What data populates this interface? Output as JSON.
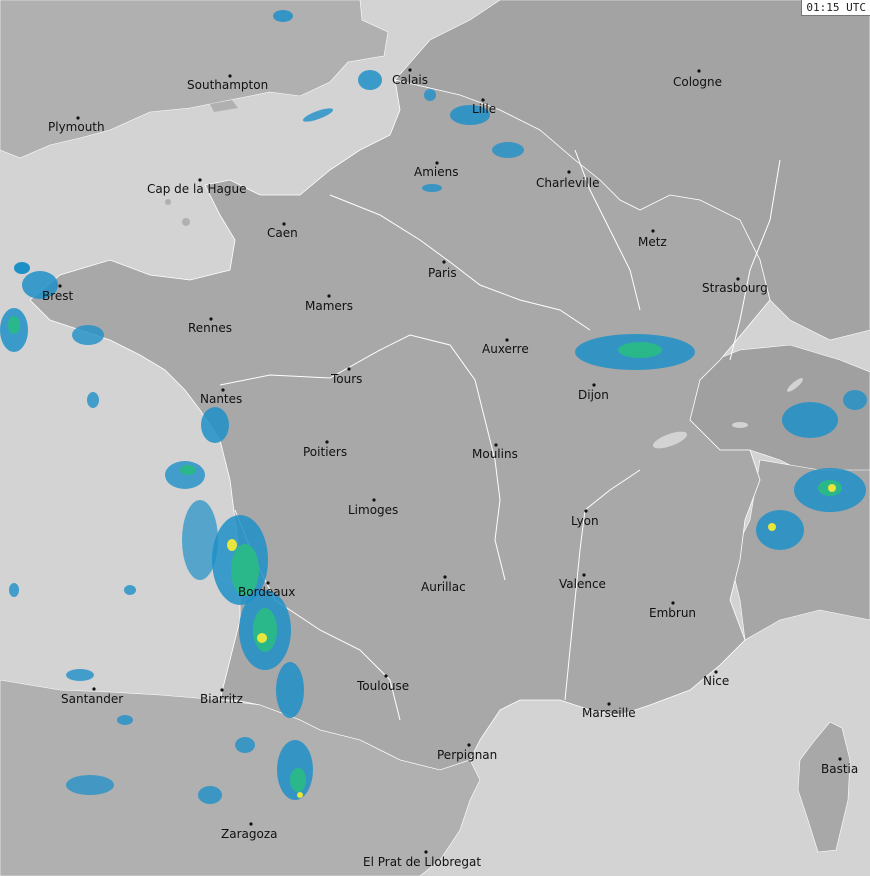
{
  "map": {
    "timestamp": "01:15 UTC",
    "colors": {
      "sea": "#d3d3d3",
      "land": "#b0b0b0",
      "france": "#a8a8a8",
      "borders": "#ffffff",
      "rain_light": "#1e90c8",
      "rain_mid": "#2ab88a",
      "rain_heavy": "#e6e63c"
    },
    "cities": [
      {
        "id": "southampton",
        "name": "Southampton"
      },
      {
        "id": "plymouth",
        "name": "Plymouth"
      },
      {
        "id": "calais",
        "name": "Calais"
      },
      {
        "id": "lille",
        "name": "Lille"
      },
      {
        "id": "cologne",
        "name": "Cologne"
      },
      {
        "id": "cap-de-la-hague",
        "name": "Cap de la Hague"
      },
      {
        "id": "amiens",
        "name": "Amiens"
      },
      {
        "id": "charleville",
        "name": "Charleville"
      },
      {
        "id": "caen",
        "name": "Caen"
      },
      {
        "id": "metz",
        "name": "Metz"
      },
      {
        "id": "paris",
        "name": "Paris"
      },
      {
        "id": "brest",
        "name": "Brest"
      },
      {
        "id": "strasbourg",
        "name": "Strasbourg"
      },
      {
        "id": "mamers",
        "name": "Mamers"
      },
      {
        "id": "rennes",
        "name": "Rennes"
      },
      {
        "id": "auxerre",
        "name": "Auxerre"
      },
      {
        "id": "tours",
        "name": "Tours"
      },
      {
        "id": "dijon",
        "name": "Dijon"
      },
      {
        "id": "nantes",
        "name": "Nantes"
      },
      {
        "id": "poitiers",
        "name": "Poitiers"
      },
      {
        "id": "moulins",
        "name": "Moulins"
      },
      {
        "id": "limoges",
        "name": "Limoges"
      },
      {
        "id": "lyon",
        "name": "Lyon"
      },
      {
        "id": "valence",
        "name": "Valence"
      },
      {
        "id": "aurillac",
        "name": "Aurillac"
      },
      {
        "id": "bordeaux",
        "name": "Bordeaux"
      },
      {
        "id": "embrun",
        "name": "Embrun"
      },
      {
        "id": "nice",
        "name": "Nice"
      },
      {
        "id": "santander",
        "name": "Santander"
      },
      {
        "id": "biarritz",
        "name": "Biarritz"
      },
      {
        "id": "toulouse",
        "name": "Toulouse"
      },
      {
        "id": "marseille",
        "name": "Marseille"
      },
      {
        "id": "bastia",
        "name": "Bastia"
      },
      {
        "id": "perpignan",
        "name": "Perpignan"
      },
      {
        "id": "zaragoza",
        "name": "Zaragoza"
      },
      {
        "id": "el-prat",
        "name": "El Prat de Llobregat"
      }
    ]
  }
}
